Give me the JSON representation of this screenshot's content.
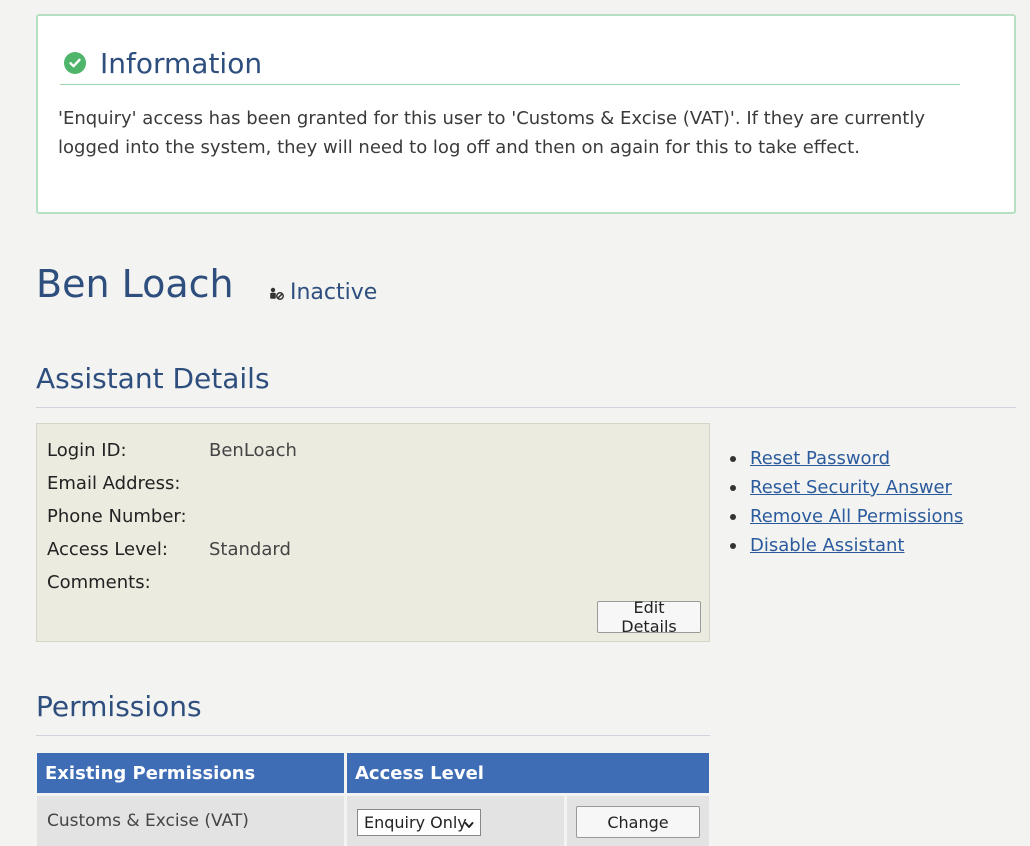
{
  "info": {
    "title": "Information",
    "message": "'Enquiry' access has been granted for this user to 'Customs & Excise (VAT)'. If they are currently logged into the system, they will need to log off and then on again for this to take effect.",
    "accent_color": "#4fb56b"
  },
  "user": {
    "name": "Ben Loach",
    "status": "Inactive"
  },
  "assistant_details": {
    "title": "Assistant Details",
    "fields": [
      {
        "label": "Login ID:",
        "value": "BenLoach"
      },
      {
        "label": "Email Address:",
        "value": ""
      },
      {
        "label": "Phone Number:",
        "value": ""
      },
      {
        "label": "Access Level:",
        "value": "Standard"
      },
      {
        "label": "Comments:",
        "value": ""
      }
    ],
    "edit_button": "Edit Details"
  },
  "actions": {
    "links": [
      "Reset Password",
      "Reset Security Answer",
      "Remove All Permissions",
      "Disable Assistant"
    ]
  },
  "permissions": {
    "title": "Permissions",
    "headers": [
      "Existing Permissions",
      "Access Level"
    ],
    "rows": [
      {
        "permission": "Customs & Excise (VAT)",
        "access_level": "Enquiry Only",
        "change_button": "Change"
      }
    ],
    "header_color": "#3e6db5"
  },
  "colors": {
    "heading": "#2e4e7e",
    "link": "#2b5b9c"
  }
}
